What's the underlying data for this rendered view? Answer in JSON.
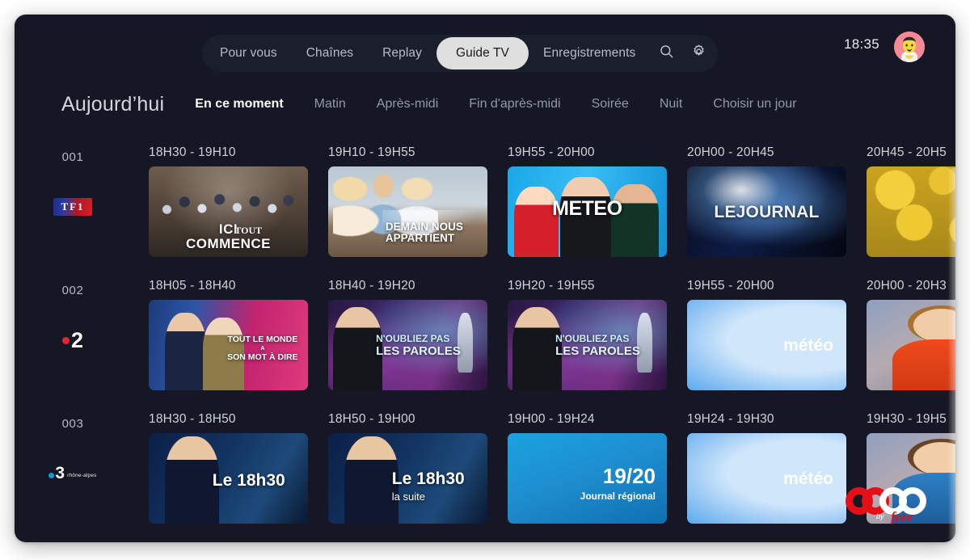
{
  "nav": {
    "items": [
      {
        "label": "Pour vous",
        "active": false
      },
      {
        "label": "Chaînes",
        "active": false
      },
      {
        "label": "Replay",
        "active": false
      },
      {
        "label": "Guide TV",
        "active": true
      },
      {
        "label": "Enregistrements",
        "active": false
      }
    ],
    "search_icon": "search-icon",
    "settings_icon": "gear-icon",
    "clock": "18:35",
    "avatar": "user-avatar"
  },
  "filters": {
    "day_label": "Aujourd’hui",
    "periods": [
      {
        "label": "En ce moment",
        "active": true
      },
      {
        "label": "Matin",
        "active": false
      },
      {
        "label": "Après-midi",
        "active": false
      },
      {
        "label": "Fin d'après-midi",
        "active": false
      },
      {
        "label": "Soirée",
        "active": false
      },
      {
        "label": "Nuit",
        "active": false
      },
      {
        "label": "Choisir un jour",
        "active": false
      }
    ]
  },
  "channels": [
    {
      "number": "001",
      "logo": "tf1-logo",
      "logo_text": "TF1",
      "programs": [
        {
          "time": "18H30 - 19H10",
          "title_line1": "ICI",
          "title_line2": "TOUT",
          "title_line3": "COMMENCE",
          "art": "ici-tout-commence"
        },
        {
          "time": "19H10 - 19H55",
          "title_line1": "DEMAIN NOUS",
          "title_line2": "APPARTIENT",
          "art": "demain-nous-appartient"
        },
        {
          "time": "19H55 - 20H00",
          "title_line1": "METEO",
          "art": "meteo-tf1"
        },
        {
          "time": "20H00 - 20H45",
          "title_line1": "LEJOURNAL",
          "art": "le-journal"
        },
        {
          "time": "20H45 - 20H5",
          "title_line1": "",
          "art": "loto"
        }
      ]
    },
    {
      "number": "002",
      "logo": "france2-logo",
      "logo_text": "2",
      "programs": [
        {
          "time": "18H05 - 18H40",
          "title_line1": "TOUT LE MONDE",
          "title_line2": "A",
          "title_line3": "SON MOT À DIRE",
          "art": "tout-le-monde-a-son-mot-a-dire"
        },
        {
          "time": "18H40 - 19H20",
          "title_line1": "N'OUBLIEZ PAS",
          "title_line2": "LES PAROLES",
          "art": "noubliez-pas-les-paroles"
        },
        {
          "time": "19H20 - 19H55",
          "title_line1": "N'OUBLIEZ PAS",
          "title_line2": "LES PAROLES",
          "art": "noubliez-pas-les-paroles"
        },
        {
          "time": "19H55 - 20H00",
          "title_line1": "météo",
          "art": "meteo-france2"
        },
        {
          "time": "20H00 - 20H3",
          "title_line1": "",
          "art": "presenter-journal"
        }
      ]
    },
    {
      "number": "003",
      "logo": "france3-rhone-alpes-logo",
      "logo_text": "3",
      "logo_sub": "rhône-alpes",
      "programs": [
        {
          "time": "18H30 - 18H50",
          "title_line1": "Le 18h30",
          "art": "le-1830"
        },
        {
          "time": "18H50 - 19H00",
          "title_line1": "Le 18h30",
          "title_line2": "la suite",
          "art": "le-1830"
        },
        {
          "time": "19H00 - 19H24",
          "title_line1": "19/20",
          "title_line2": "Journal régional",
          "art": "1920-journal-regional"
        },
        {
          "time": "19H24 - 19H30",
          "title_line1": "météo",
          "art": "meteo-france2"
        },
        {
          "time": "19H30 - 19H5",
          "title_line1": "",
          "art": "presenter-regional"
        }
      ]
    }
  ],
  "watermark": {
    "brand": "OQEE",
    "by": "by",
    "provider": "free"
  },
  "colors": {
    "panel_bg": "#151824",
    "nav_pill_bg": "#1b1e2b",
    "active_pill_bg": "#dfdfe0",
    "text_primary": "#ffffff",
    "text_muted": "#9498a7",
    "brand_red": "#e60f18",
    "france2_red": "#e52534",
    "france3_blue": "#0a9ade"
  }
}
